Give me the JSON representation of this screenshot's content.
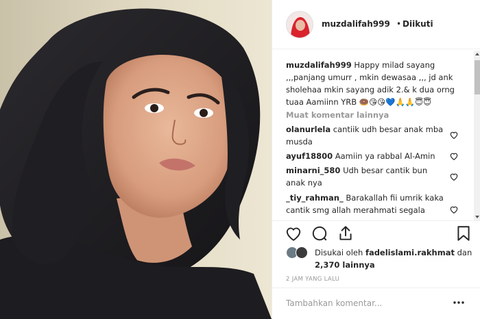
{
  "post": {
    "username": "muzdalifah999",
    "separator": "•",
    "follow_status": "Diikuti",
    "caption_text": "Happy milad sayang ,,,panjang umurr , mkin dewasaa ,,, jd ank sholehaa mkin sayang adik 2.& k dua orng tuaa Aamiinn YRB 🍩😘😘💙🙏🙏😇😇",
    "more_comments": "Muat komentar lainnya",
    "comments": [
      {
        "user": "olanurlela",
        "text": "cantiik udh besar anak mba musda"
      },
      {
        "user": "ayuf18800",
        "text": "Aamiin ya rabbal Al-Amin"
      },
      {
        "user": "minarni_580",
        "text": "Udh besar cantik bun anak nya"
      },
      {
        "user": "_tiy_rahman_",
        "text": "Barakallah fii umrik kaka cantik smg allah merahmati segala"
      }
    ],
    "likes": {
      "prefix": "Disukai oleh",
      "user": "fadelislami.rakhmat",
      "joiner": "dan",
      "count": "2,370 lainnya"
    },
    "timestamp": "2 JAM YANG LALU",
    "add_comment_placeholder": "Tambahkan komentar..."
  },
  "icons": [
    "heart-icon",
    "comment-icon",
    "share-icon",
    "bookmark-icon",
    "more-dots-icon"
  ],
  "colors": {
    "border": "#efefef",
    "muted": "#999999",
    "text": "#262626",
    "avatar_hijab": "#d9232d"
  }
}
